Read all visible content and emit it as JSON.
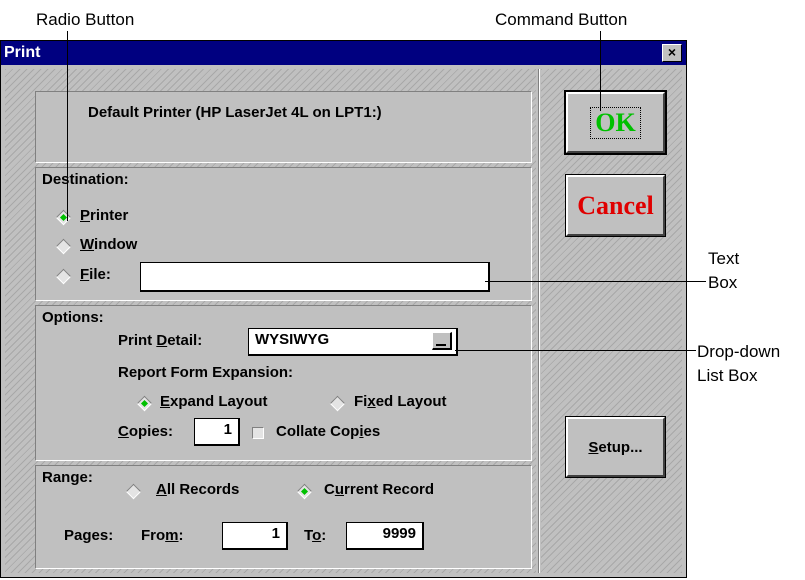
{
  "callouts": {
    "radio_button": "Radio Button",
    "command_button": "Command Button",
    "text_box_line1": "Text",
    "text_box_line2": "Box",
    "dropdown_line1": "Drop-down",
    "dropdown_line2": "List Box"
  },
  "dialog": {
    "title": "Print",
    "close_glyph": "×",
    "default_printer": "Default Printer (HP LaserJet 4L on LPT1:)"
  },
  "destination": {
    "label": "Destination:",
    "printer": {
      "text": "rinter",
      "mnemonic": "P",
      "selected": true
    },
    "window": {
      "text": "indow",
      "mnemonic": "W",
      "selected": false
    },
    "file": {
      "text": "ile:",
      "mnemonic": "F",
      "selected": false
    },
    "file_value": ""
  },
  "options": {
    "label": "Options:",
    "print_detail_prefix": "Print ",
    "print_detail_mnemonic": "D",
    "print_detail_suffix": "etail:",
    "print_detail_value": "WYSIWYG",
    "expansion_label": "Report Form Expansion:",
    "expand_mnemonic": "E",
    "expand_text": "xpand Layout",
    "expand_selected": true,
    "fixed_prefix": "Fi",
    "fixed_mnemonic": "x",
    "fixed_suffix": "ed Layout",
    "fixed_selected": false,
    "copies_mnemonic": "C",
    "copies_suffix": "opies:",
    "copies_value": "1",
    "collate_prefix": "Collate Cop",
    "collate_mnemonic": "i",
    "collate_suffix": "es",
    "collate_checked": false
  },
  "range": {
    "label": "Range:",
    "all_mnemonic": "A",
    "all_text": "ll Records",
    "all_selected": false,
    "current_prefix": "C",
    "current_mnemonic": "u",
    "current_suffix": "rrent Record",
    "current_selected": true,
    "pages_label": "Pages:",
    "from_prefix": "Fro",
    "from_mnemonic": "m",
    "from_suffix": ":",
    "from_value": "1",
    "to_prefix": "T",
    "to_mnemonic": "o",
    "to_suffix": ":",
    "to_value": "9999"
  },
  "buttons": {
    "ok": "OK",
    "ok_color": "#00c000",
    "cancel": "Cancel",
    "cancel_color": "#e00000",
    "setup_mnemonic": "S",
    "setup_suffix": "etup..."
  }
}
